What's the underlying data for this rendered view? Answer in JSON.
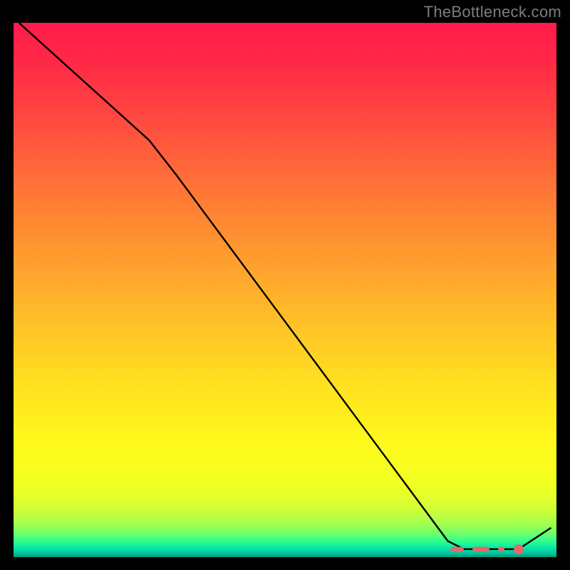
{
  "attribution": "TheBottleneck.com",
  "chart_data": {
    "type": "line",
    "title": "",
    "xlabel": "",
    "ylabel": "",
    "xlim": [
      0,
      100
    ],
    "ylim": [
      0,
      100
    ],
    "series": [
      {
        "name": "curve",
        "points": [
          {
            "x": 1.0,
            "y": 100.0
          },
          {
            "x": 25.0,
            "y": 78.0
          },
          {
            "x": 30.0,
            "y": 71.5
          },
          {
            "x": 80.0,
            "y": 3.0
          },
          {
            "x": 83.0,
            "y": 1.5
          },
          {
            "x": 93.0,
            "y": 1.5
          },
          {
            "x": 99.0,
            "y": 5.5
          }
        ]
      }
    ],
    "points": [
      {
        "name": "marker-1",
        "x": 93.0,
        "y": 1.5
      }
    ],
    "dashes": [
      {
        "x": 80.5,
        "w": 2.5
      },
      {
        "x": 84.5,
        "w": 3.2
      },
      {
        "x": 89.2,
        "w": 1.2
      }
    ],
    "colors": {
      "curve": "#000000",
      "marker": "#e46868",
      "dash": "#e46868",
      "background_top": "#ff1b4a",
      "background_bottom": "#009878"
    }
  }
}
